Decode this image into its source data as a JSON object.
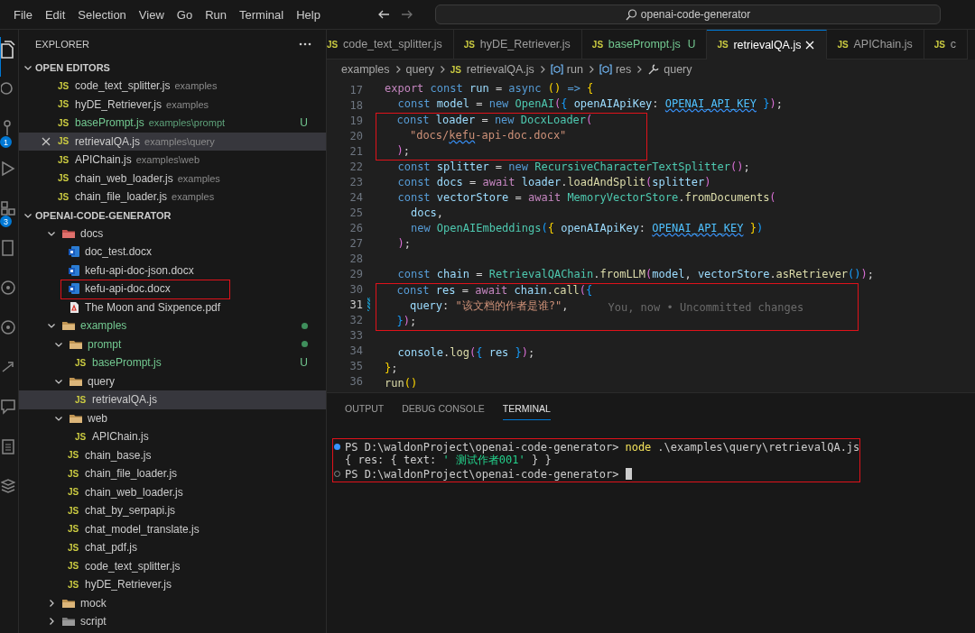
{
  "menu": [
    "File",
    "Edit",
    "Selection",
    "View",
    "Go",
    "Run",
    "Terminal",
    "Help"
  ],
  "command_center": {
    "text": "openai-code-generator"
  },
  "activity_bar": [
    {
      "kind": "explorer",
      "selected": true
    },
    {
      "kind": "search",
      "selected": false
    },
    {
      "kind": "source-control",
      "selected": false,
      "badge": "1"
    },
    {
      "kind": "run",
      "selected": false
    },
    {
      "kind": "extensions",
      "selected": false,
      "badge": "3"
    },
    {
      "kind": "book",
      "selected": false
    },
    {
      "kind": "circle",
      "selected": false
    },
    {
      "kind": "gauge",
      "selected": false
    },
    {
      "kind": "share",
      "selected": false
    },
    {
      "kind": "chat",
      "selected": false
    },
    {
      "kind": "clipboard",
      "selected": false
    },
    {
      "kind": "stack",
      "selected": false
    }
  ],
  "sidebar": {
    "title": "EXPLORER",
    "open_editors": {
      "title": "OPEN EDITORS",
      "expanded": true,
      "items": [
        {
          "name": "code_text_splitter.js",
          "path": "examples",
          "icon_label": "JS",
          "selected": false
        },
        {
          "name": "hyDE_Retriever.js",
          "path": "examples",
          "icon_label": "JS",
          "selected": false
        },
        {
          "name": "basePrompt.js",
          "path": "examples\\prompt",
          "icon_label": "JS",
          "selected": false,
          "untracked": true,
          "decoration": "U"
        },
        {
          "name": "retrievalQA.js",
          "path": "examples\\query",
          "icon_label": "JS",
          "selected": true
        },
        {
          "name": "APIChain.js",
          "path": "examples\\web",
          "icon_label": "JS",
          "selected": false
        },
        {
          "name": "chain_web_loader.js",
          "path": "examples",
          "icon_label": "JS",
          "selected": false
        },
        {
          "name": "chain_file_loader.js",
          "path": "examples",
          "icon_label": "JS",
          "selected": false
        }
      ]
    },
    "project": {
      "title": "OPENAI-CODE-GENERATOR",
      "expanded": true,
      "tree": [
        {
          "name": "docs",
          "kind": "folder-docs",
          "expanded": true,
          "selected": false,
          "children": [
            {
              "name": "doc_test.docx",
              "kind": "word",
              "selected": false
            },
            {
              "name": "kefu-api-doc-json.docx",
              "kind": "word",
              "selected": false
            },
            {
              "name": "kefu-api-doc.docx",
              "kind": "word",
              "selected": false,
              "highlighted": true
            },
            {
              "name": "The Moon and Sixpence.pdf",
              "kind": "pdf",
              "selected": false
            }
          ]
        },
        {
          "name": "examples",
          "kind": "folder",
          "expanded": true,
          "selected": false,
          "untracked": true,
          "dot": true,
          "children": [
            {
              "name": "prompt",
              "kind": "folder",
              "expanded": true,
              "selected": false,
              "untracked": true,
              "dot": true,
              "children": [
                {
                  "name": "basePrompt.js",
                  "kind": "js",
                  "icon_label": "JS",
                  "selected": false,
                  "untracked": true,
                  "decoration": "U"
                }
              ]
            },
            {
              "name": "query",
              "kind": "folder",
              "expanded": true,
              "selected": false,
              "children": [
                {
                  "name": "retrievalQA.js",
                  "kind": "js",
                  "icon_label": "JS",
                  "selected": true
                }
              ]
            },
            {
              "name": "web",
              "kind": "folder",
              "expanded": true,
              "selected": false,
              "children": [
                {
                  "name": "APIChain.js",
                  "kind": "js",
                  "icon_label": "JS",
                  "selected": false
                }
              ]
            },
            {
              "name": "chain_base.js",
              "kind": "js",
              "icon_label": "JS",
              "selected": false
            },
            {
              "name": "chain_file_loader.js",
              "kind": "js",
              "icon_label": "JS",
              "selected": false
            },
            {
              "name": "chain_web_loader.js",
              "kind": "js",
              "icon_label": "JS",
              "selected": false
            },
            {
              "name": "chat_by_serpapi.js",
              "kind": "js",
              "icon_label": "JS",
              "selected": false
            },
            {
              "name": "chat_model_translate.js",
              "kind": "js",
              "icon_label": "JS",
              "selected": false
            },
            {
              "name": "chat_pdf.js",
              "kind": "js",
              "icon_label": "JS",
              "selected": false
            },
            {
              "name": "code_text_splitter.js",
              "kind": "js",
              "icon_label": "JS",
              "selected": false
            },
            {
              "name": "hyDE_Retriever.js",
              "kind": "js",
              "icon_label": "JS",
              "selected": false
            }
          ]
        },
        {
          "name": "mock",
          "kind": "folder",
          "expanded": false,
          "selected": false
        },
        {
          "name": "script",
          "kind": "folder-script",
          "expanded": false,
          "selected": false
        }
      ]
    }
  },
  "tabs": [
    {
      "label": "code_text_splitter.js",
      "icon_label": "JS",
      "selected": false
    },
    {
      "label": "hyDE_Retriever.js",
      "icon_label": "JS",
      "selected": false
    },
    {
      "label": "basePrompt.js",
      "icon_label": "JS",
      "selected": false,
      "untracked": true,
      "decoration": "U"
    },
    {
      "label": "retrievalQA.js",
      "icon_label": "JS",
      "selected": true
    },
    {
      "label": "APIChain.js",
      "icon_label": "JS",
      "selected": false
    },
    {
      "label": "c",
      "icon_label": "JS",
      "selected": false
    }
  ],
  "breadcrumb": [
    {
      "label": "examples"
    },
    {
      "label": "query"
    },
    {
      "label": "retrievalQA.js",
      "kind": "js",
      "icon_label": "JS"
    },
    {
      "label": "run",
      "kind": "variable"
    },
    {
      "label": "res",
      "kind": "variable"
    },
    {
      "label": "query",
      "kind": "property"
    }
  ],
  "code": {
    "lines": [
      {
        "n": "17",
        "text": "export const run = async () => {"
      },
      {
        "n": "18",
        "segments": [
          {
            "text": "  const model = new OpenAI({ openAIApiKey: "
          },
          {
            "text": "OPENAI_API_KEY",
            "warning": true
          },
          {
            "text": " });"
          }
        ]
      },
      {
        "n": "19",
        "highlighted": true,
        "text": "  const loader = new DocxLoader("
      },
      {
        "n": "20",
        "highlighted": true,
        "segments": [
          {
            "text": "    \"docs/"
          },
          {
            "text": "kefu",
            "warning": true
          },
          {
            "text": "-api-doc.docx\""
          }
        ]
      },
      {
        "n": "21",
        "highlighted": true,
        "text": "  );"
      },
      {
        "n": "22",
        "text": "  const splitter = new RecursiveCharacterTextSplitter();"
      },
      {
        "n": "23",
        "text": "  const docs = await loader.loadAndSplit(splitter)"
      },
      {
        "n": "24",
        "text": "  const vectorStore = await MemoryVectorStore.fromDocuments("
      },
      {
        "n": "25",
        "text": "    docs,"
      },
      {
        "n": "26",
        "segments": [
          {
            "text": "    new OpenAIEmbeddings({ openAIApiKey: "
          },
          {
            "text": "OPENAI_API_KEY",
            "warning": true
          },
          {
            "text": " })"
          }
        ]
      },
      {
        "n": "27",
        "text": "  );"
      },
      {
        "n": "28"
      },
      {
        "n": "29",
        "text": "  const chain = RetrievalQAChain.fromLLM(model, vectorStore.asRetriever());"
      },
      {
        "n": "30",
        "highlighted": true,
        "text": "  const res = await chain.call({"
      },
      {
        "n": "31",
        "highlighted": true,
        "current": true,
        "modified": true,
        "blame": "You, now • Uncommitted changes",
        "text": "    query: \"该文档的作者是谁?\","
      },
      {
        "n": "32",
        "highlighted": true,
        "text": "  });"
      },
      {
        "n": "33"
      },
      {
        "n": "34",
        "text": "  console.log({ res });"
      },
      {
        "n": "35",
        "text": "};"
      },
      {
        "n": "36",
        "text": "run()"
      }
    ]
  },
  "panel": {
    "tabs": [
      {
        "label": "OUTPUT",
        "selected": false
      },
      {
        "label": "DEBUG CONSOLE",
        "selected": false
      },
      {
        "label": "TERMINAL",
        "selected": true
      }
    ],
    "terminal": {
      "highlighted": true,
      "lines": [
        {
          "succeeded": true,
          "prompt": "PS D:\\waldonProject\\openai-code-generator>",
          "command": "node",
          "args": ".\\examples\\query\\retrievalQA.js"
        },
        {
          "output": "{ res: { text: ' 测试作者001' } }"
        },
        {
          "succeeded": false,
          "cursor": true,
          "prompt": "PS D:\\waldonProject\\openai-code-generator>"
        }
      ]
    }
  }
}
